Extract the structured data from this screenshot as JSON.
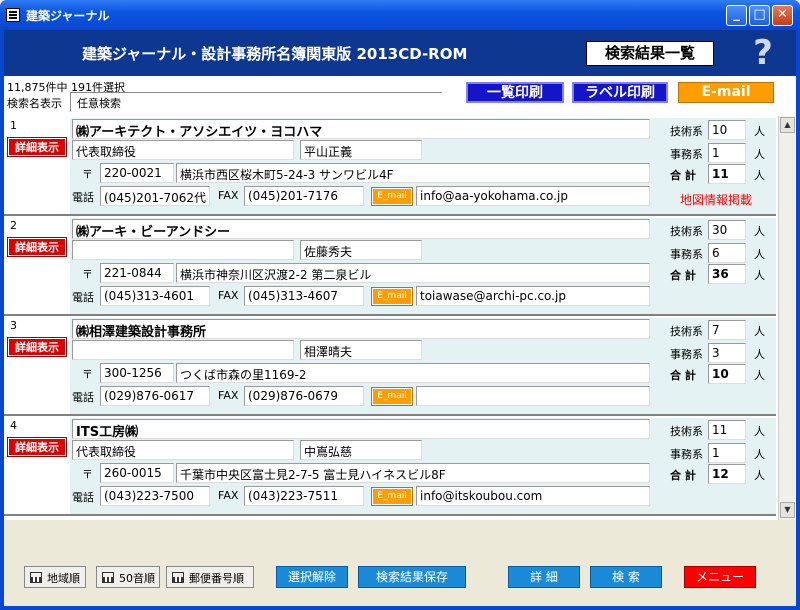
{
  "window": {
    "title": "建築ジャーナル",
    "min": "_",
    "max": "□",
    "close": "✕"
  },
  "banner": {
    "title": "建築ジャーナル・設計事務所名簿関東版 2013CD-ROM",
    "result_label": "検索結果一覧",
    "help": "?"
  },
  "info": {
    "count": "11,875件中 191件選択",
    "search_name_label": "検索名表示",
    "search_name_value": "任意検索"
  },
  "toolbar": {
    "list_print": "一覧印刷",
    "label_print": "ラベル印刷",
    "email": "E-mail"
  },
  "labels": {
    "postal": "〒",
    "phone": "電話",
    "fax": "FAX",
    "email_btn": "E_mail",
    "detail": "詳細表示",
    "tech": "技術系",
    "office": "事務系",
    "total": "合 計",
    "person": "人"
  },
  "records": [
    {
      "num": "1",
      "company": "㈱アーキテクト・アソシエイツ・ヨコハマ",
      "title": "代表取締役",
      "person": "平山正義",
      "postal": "220-0021",
      "address": "横浜市西区桜木町5-24-3 サンワビル4F",
      "phone": "(045)201-7062代",
      "fax": "(045)201-7176",
      "email": "info@aa-yokohama.co.jp",
      "tech": "10",
      "office": "1",
      "total": "11",
      "map": "地図情報掲載"
    },
    {
      "num": "2",
      "company": "㈱アーキ・ビーアンドシー",
      "title": "",
      "person": "佐藤秀夫",
      "postal": "221-0844",
      "address": "横浜市神奈川区沢渡2-2 第二泉ビル",
      "phone": "(045)313-4601",
      "fax": "(045)313-4607",
      "email": "toiawase@archi-pc.co.jp",
      "tech": "30",
      "office": "6",
      "total": "36",
      "map": ""
    },
    {
      "num": "3",
      "company": "㈱相澤建築設計事務所",
      "title": "",
      "person": "相澤晴夫",
      "postal": "300-1256",
      "address": "つくば市森の里1169-2",
      "phone": "(029)876-0617",
      "fax": "(029)876-0679",
      "email": "",
      "tech": "7",
      "office": "3",
      "total": "10",
      "map": ""
    },
    {
      "num": "4",
      "company": "ITS工房㈱",
      "title": "代表取締役",
      "person": "中嶌弘慈",
      "postal": "260-0015",
      "address": "千葉市中央区富士見2-7-5 富士見ハイネスビル8F",
      "phone": "(043)223-7500",
      "fax": "(043)223-7511",
      "email": "info@itskoubou.com",
      "tech": "11",
      "office": "1",
      "total": "12",
      "map": ""
    }
  ],
  "bottom": {
    "sort_region": "地域順",
    "sort_kana": "50音順",
    "sort_postal": "郵便番号順",
    "deselect": "選択解除",
    "save_results": "検索結果保存",
    "detail": "詳 細",
    "search": "検 索",
    "menu": "メニュー"
  }
}
